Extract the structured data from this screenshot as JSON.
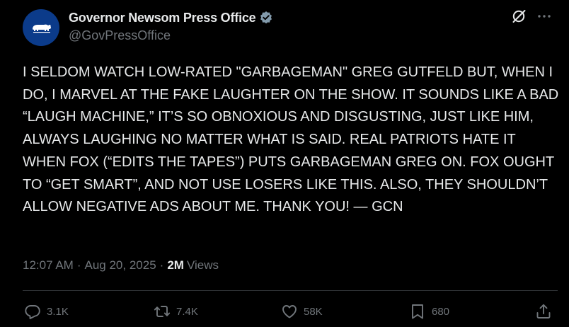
{
  "account": {
    "display_name": "Governor Newsom Press Office",
    "handle": "@GovPressOffice",
    "verified_icon": "verified-badge-icon",
    "avatar_color": "#0b3b8a"
  },
  "tweet": {
    "text": "I SELDOM WATCH LOW-RATED \"GARBAGEMAN\" GREG GUTFELD BUT, WHEN I DO, I MARVEL AT THE FAKE LAUGHTER ON THE SHOW. IT SOUNDS LIKE A BAD “LAUGH MACHINE,” IT’S SO OBNOXIOUS AND DISGUSTING, JUST LIKE HIM, ALWAYS LAUGHING NO MATTER WHAT IS SAID. REAL PATRIOTS HATE IT WHEN FOX (“EDITS THE TAPES”) PUTS GARBAGEMAN GREG ON. FOX OUGHT TO “GET SMART”, AND NOT USE LOSERS LIKE THIS. ALSO, THEY SHOULDN’T ALLOW NEGATIVE ADS ABOUT ME. THANK YOU! — GCN",
    "time": "12:07 AM",
    "date": "Aug 20, 2025",
    "views_count": "2M",
    "views_label": "Views"
  },
  "actions": {
    "replies": "3.1K",
    "reposts": "7.4K",
    "likes": "58K",
    "bookmarks": "680"
  },
  "colors": {
    "background": "#000000",
    "text": "#e7e9ea",
    "secondary": "#71767b",
    "verified": "#829aab",
    "divider": "#2f3336"
  }
}
